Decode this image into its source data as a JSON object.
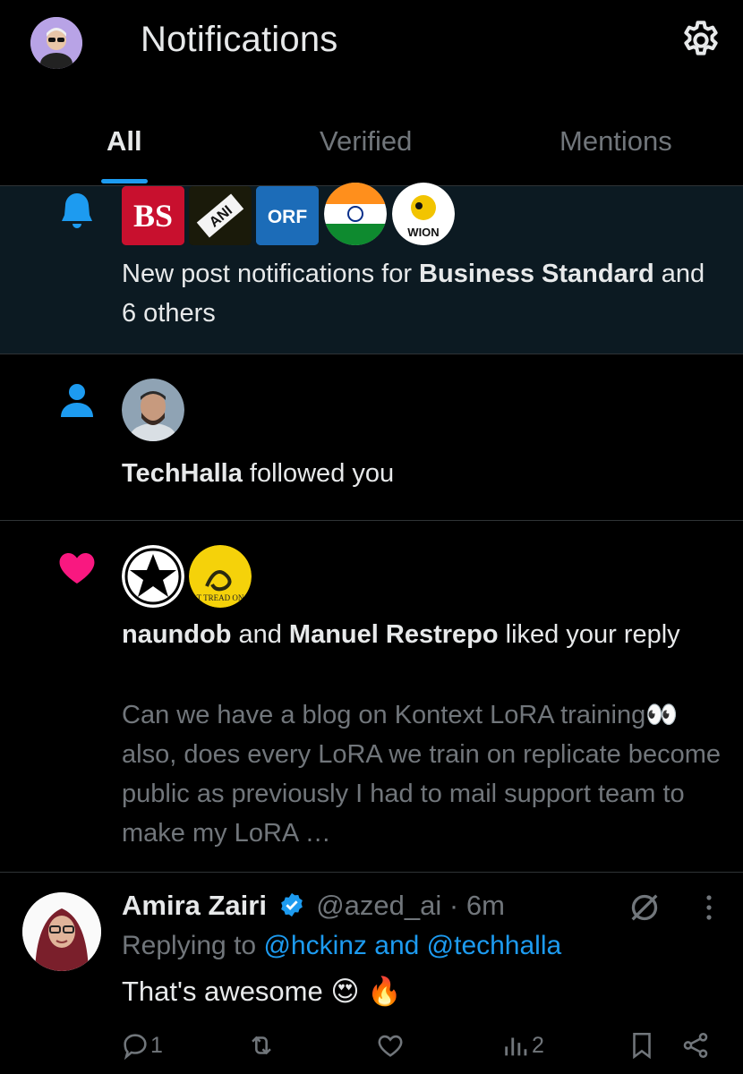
{
  "header": {
    "title": "Notifications",
    "tabs": [
      {
        "label": "All",
        "active": true
      },
      {
        "label": "Verified",
        "active": false
      },
      {
        "label": "Mentions",
        "active": false
      }
    ]
  },
  "notifications": [
    {
      "type": "new-post",
      "icon": "bell-icon",
      "avatars": [
        "BS",
        "ANI",
        "ORF",
        "India flag",
        "WION"
      ],
      "text_prefix": "New post notifications for ",
      "bold_name": "Business Standard",
      "text_suffix": " and 6 others"
    },
    {
      "type": "follow",
      "icon": "person-icon",
      "bold_name": "TechHalla",
      "text_suffix": " followed you"
    },
    {
      "type": "like",
      "icon": "heart-icon",
      "bold_name_1": "naundob",
      "and": " and ",
      "bold_name_2": "Manuel Restrepo",
      "text_suffix": " liked your reply",
      "snippet": "Can we have a blog on Kontext LoRA training👀 also, does every LoRA we train on replicate become public as previously I had to mail support team to make my LoRA …"
    }
  ],
  "tweet": {
    "name": "Amira Zairi",
    "handle": "@azed_ai",
    "separator": " · ",
    "time": "6m",
    "replying_prefix": "Replying to ",
    "replying_to": "@hckinz and @techhalla",
    "body": "That's awesome 😍 🔥",
    "replies": "1",
    "retweets": "",
    "likes": "",
    "views": "2"
  },
  "colors": {
    "accent": "#1d9bf0",
    "like": "#f91880",
    "unread_bg": "#0c1a22",
    "muted": "#71767b"
  }
}
